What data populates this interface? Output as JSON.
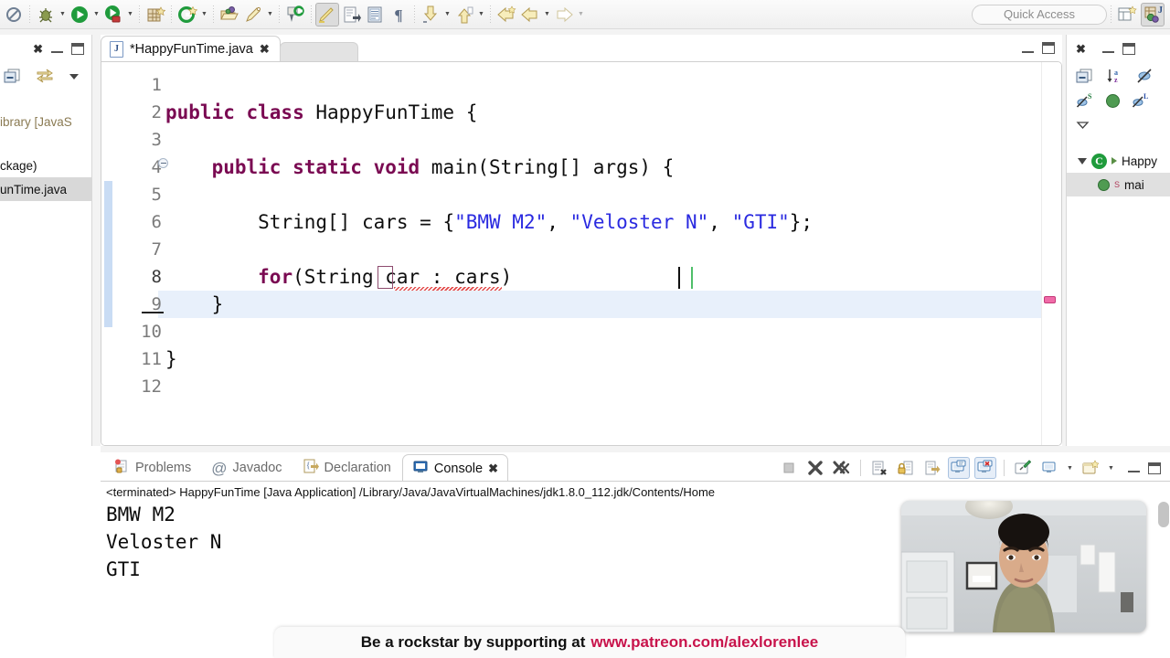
{
  "toolbar": {
    "items": [
      {
        "name": "no-entry-icon",
        "glyph": "no"
      },
      {
        "name": "debug-icon",
        "glyph": "bug",
        "dropdown": true
      },
      {
        "name": "run-icon",
        "glyph": "run",
        "dropdown": true
      },
      {
        "name": "coverage-icon",
        "glyph": "coverage",
        "dropdown": true
      },
      {
        "name": "new-icon",
        "glyph": "newgrid"
      },
      {
        "name": "new-java-class-icon",
        "glyph": "greenC",
        "dropdown": true
      },
      {
        "name": "open-type-icon",
        "glyph": "folderball"
      },
      {
        "name": "external-tools-icon",
        "glyph": "pen",
        "dropdown": true
      },
      {
        "name": "search-icon",
        "glyph": "searchpin"
      },
      {
        "name": "highlight-icon",
        "glyph": "marker",
        "pressed": true
      },
      {
        "name": "next-annotation-icon",
        "glyph": "pagearrow"
      },
      {
        "name": "show-whitespace-icon",
        "glyph": "doclines"
      },
      {
        "name": "pilcrow-icon",
        "glyph": "pilcrow"
      },
      {
        "name": "next-edit-location-icon",
        "glyph": "downarrow",
        "dropdown": true
      },
      {
        "name": "previous-edit-location-icon",
        "glyph": "uparrow",
        "dropdown": true
      },
      {
        "name": "back-icon",
        "glyph": "leftarrow",
        "dropdown": true
      },
      {
        "name": "forward-icon",
        "glyph": "leftarrow2",
        "dropdown": true,
        "dim": true
      }
    ],
    "quick_access_placeholder": "Quick Access",
    "right_icons": [
      {
        "name": "open-perspective-icon"
      },
      {
        "name": "java-perspective-icon",
        "pressed": true
      }
    ]
  },
  "package_explorer": {
    "close_label": "✖",
    "tree": [
      {
        "label": "ibrary [JavaS",
        "type": "library",
        "selected": false
      },
      {
        "label": "ckage)",
        "type": "package",
        "selected": false
      },
      {
        "label": "unTime.java",
        "type": "file",
        "selected": true
      }
    ]
  },
  "editor": {
    "tab": {
      "label": "*HappyFunTime.java",
      "file_icon_letter": "J",
      "dirty": true
    },
    "lines": [
      {
        "num": "1",
        "code": "",
        "kind": "plain"
      },
      {
        "num": "2",
        "code": "public class HappyFunTime {",
        "kind": "class"
      },
      {
        "num": "3",
        "code": "",
        "kind": "plain"
      },
      {
        "num": "4",
        "code": "    public static void main(String[] args) {",
        "kind": "method",
        "fold": true
      },
      {
        "num": "5",
        "code": "",
        "kind": "plain"
      },
      {
        "num": "6",
        "code": "        String[] cars = {\"BMW M2\", \"Veloster N\", \"GTI\"};",
        "kind": "decl"
      },
      {
        "num": "7",
        "code": "",
        "kind": "plain"
      },
      {
        "num": "8",
        "code": "        for(String car : cars)",
        "kind": "forloop",
        "error": true,
        "current": true
      },
      {
        "num": "9",
        "code": "    }",
        "kind": "plain"
      },
      {
        "num": "10",
        "code": "",
        "kind": "plain"
      },
      {
        "num": "11",
        "code": "}",
        "kind": "plain"
      },
      {
        "num": "12",
        "code": "",
        "kind": "plain"
      }
    ],
    "keywords_line2": {
      "kw": "public class",
      "rest": " HappyFunTime {"
    },
    "keywords_line4": {
      "indent": "    ",
      "kw": "public static void",
      "rest": " main(String[] args) {"
    },
    "line6": {
      "indent": "        ",
      "pre": "String[] cars = {",
      "s1": "\"BMW M2\"",
      "c1": ", ",
      "s2": "\"Veloster N\"",
      "c2": ", ",
      "s3": "\"GTI\"",
      "post": "};"
    },
    "line8": {
      "indent": "        ",
      "kw": "for",
      "rest": "(String car : cars)"
    },
    "line9": "    }",
    "line11": "}"
  },
  "outline": {
    "close_label": "✖",
    "items": [
      {
        "label": "Happy",
        "type": "class",
        "selected": false
      },
      {
        "label": "mai",
        "type": "method",
        "badge": "S",
        "selected": true
      }
    ]
  },
  "console": {
    "tabs": [
      {
        "label": "Problems",
        "icon": "problems-icon",
        "active": false
      },
      {
        "label": "Javadoc",
        "icon": "javadoc-icon",
        "active": false
      },
      {
        "label": "Declaration",
        "icon": "declaration-icon",
        "active": false
      },
      {
        "label": "Console",
        "icon": "console-icon",
        "active": true
      }
    ],
    "header": "<terminated> HappyFunTime [Java Application] /Library/Java/JavaVirtualMachines/jdk1.8.0_112.jdk/Contents/Home",
    "output": [
      "BMW M2",
      "Veloster N",
      "GTI"
    ],
    "tools": [
      {
        "name": "terminate-icon"
      },
      {
        "name": "remove-launch-icon"
      },
      {
        "name": "remove-all-terminated-icon"
      },
      {
        "name": "clear-console-icon"
      },
      {
        "name": "scroll-lock-icon"
      },
      {
        "name": "word-wrap-icon"
      },
      {
        "name": "show-console-when-output-icon",
        "active": true
      },
      {
        "name": "show-console-on-error-icon",
        "active": true
      },
      {
        "name": "pin-console-icon"
      },
      {
        "name": "display-selected-console-icon",
        "dropdown": true
      },
      {
        "name": "open-console-icon",
        "dropdown": true
      },
      {
        "name": "minimize-icon"
      },
      {
        "name": "maximize-icon"
      }
    ]
  },
  "banner": {
    "prefix": "Be a rockstar by supporting at",
    "url": "www.patreon.com/alexlorenlee"
  }
}
